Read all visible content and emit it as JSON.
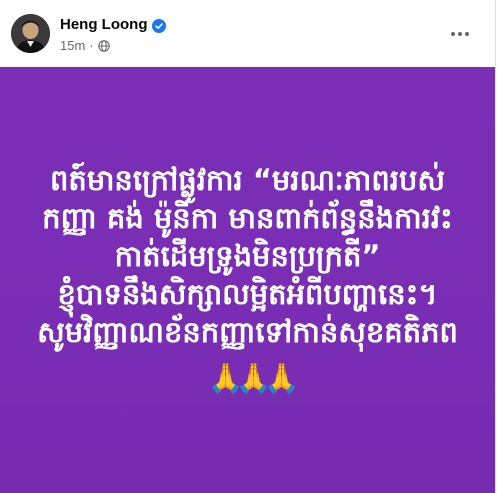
{
  "post": {
    "author": {
      "name": "Heng Loong",
      "verified": true
    },
    "timestamp": "15m",
    "separator": "·",
    "audience_icon": "globe-icon",
    "more_icon": "more-options-icon",
    "background_color": "#7a2fb5",
    "text_color": "#ffffff",
    "text": "ពត៍មានក្រៅផ្លូវការ “មរណៈភាពរបស់កញ្ញា គង់ ម៉ូនីកា មានពាក់ព័ន្ធនឹងការវះកាត់ដើមទ្រូងមិនប្រក្រតី”\nខ្ញុំបាទនឹងសិក្សាលម្អិតអំពីបញ្ហានេះ។\nសូមវិញ្ញាណខ័នកញ្ញាទៅកាន់សុខគតិភព",
    "emojis": [
      "🙏",
      "🙏",
      "🙏"
    ]
  }
}
